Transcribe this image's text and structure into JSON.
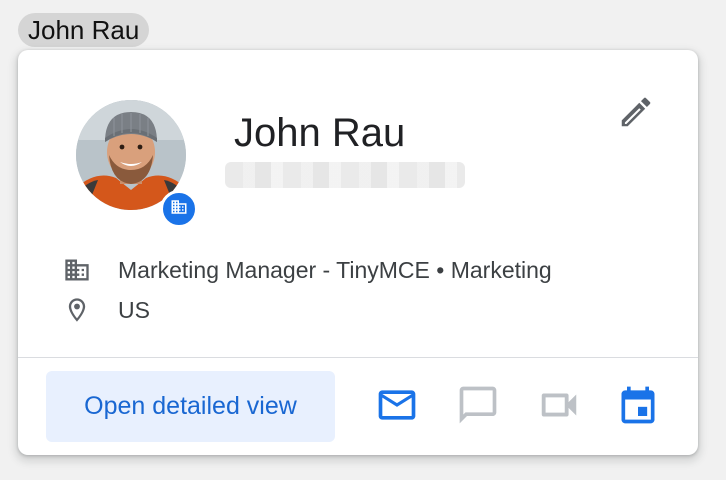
{
  "mention": {
    "label": "John Rau"
  },
  "profile": {
    "name": "John Rau",
    "job": "Marketing Manager - TinyMCE • Marketing",
    "location": "US"
  },
  "actions": {
    "open_label": "Open detailed view"
  },
  "icons": {
    "edit": "pencil-icon",
    "org": "building-icon",
    "location": "location-pin-icon",
    "email": "mail-icon",
    "chat": "chat-icon",
    "video": "video-icon",
    "calendar": "calendar-icon"
  },
  "colors": {
    "accent": "#1a73e8",
    "button_bg": "#e8f0fe",
    "button_text": "#1967d2",
    "disabled_icon": "#bdc1c6",
    "muted_icon": "#5f6368"
  }
}
